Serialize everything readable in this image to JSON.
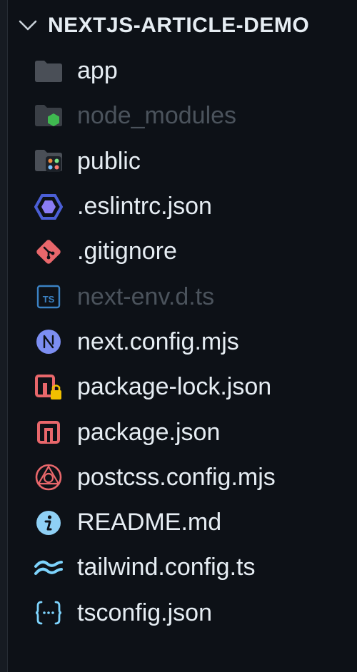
{
  "explorer": {
    "title": "NEXTJS-ARTICLE-DEMO",
    "items": [
      {
        "label": "app",
        "icon": "folder-icon",
        "type": "folder",
        "dim": false
      },
      {
        "label": "node_modules",
        "icon": "node-modules-folder-icon",
        "type": "folder",
        "dim": true
      },
      {
        "label": "public",
        "icon": "public-folder-icon",
        "type": "folder",
        "dim": false
      },
      {
        "label": ".eslintrc.json",
        "icon": "eslint-icon",
        "type": "file",
        "dim": false
      },
      {
        "label": ".gitignore",
        "icon": "git-icon",
        "type": "file",
        "dim": false
      },
      {
        "label": "next-env.d.ts",
        "icon": "typescript-icon",
        "type": "file",
        "dim": true
      },
      {
        "label": "next.config.mjs",
        "icon": "nextjs-icon",
        "type": "file",
        "dim": false
      },
      {
        "label": "package-lock.json",
        "icon": "npm-lock-icon",
        "type": "file",
        "dim": false
      },
      {
        "label": "package.json",
        "icon": "npm-icon",
        "type": "file",
        "dim": false
      },
      {
        "label": "postcss.config.mjs",
        "icon": "postcss-icon",
        "type": "file",
        "dim": false
      },
      {
        "label": "README.md",
        "icon": "info-icon",
        "type": "file",
        "dim": false
      },
      {
        "label": "tailwind.config.ts",
        "icon": "tailwind-icon",
        "type": "file",
        "dim": false
      },
      {
        "label": "tsconfig.json",
        "icon": "json-icon",
        "type": "file",
        "dim": false
      }
    ]
  },
  "colors": {
    "background": "#0d1117",
    "text": "#e6edf3",
    "dim_text": "#4b535c",
    "folder": "#4a4f57",
    "eslint": "#4b32c3",
    "git": "#f05033",
    "typescript": "#3178c6",
    "next": "#7c8ef2",
    "npm": "#e8676b",
    "info": "#7ec3f0",
    "tailwind": "#7dd3fc"
  }
}
